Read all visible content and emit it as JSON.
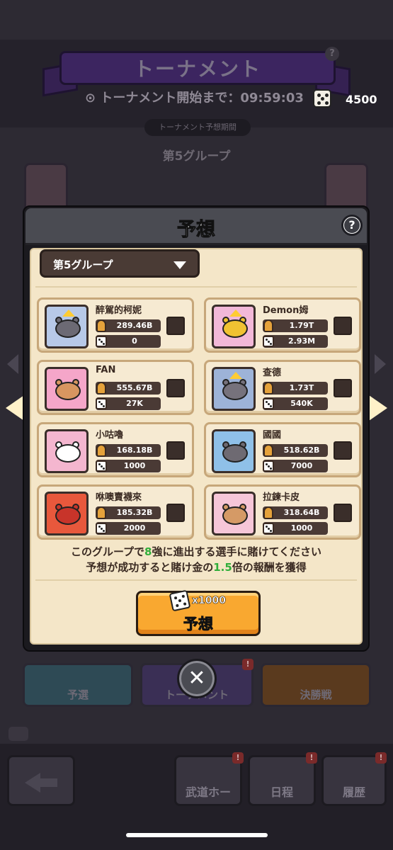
{
  "background": {
    "title": "トーナメント",
    "timer_label": "トーナメント開始まで：",
    "timer_value": "09:59:03",
    "currency": "4500",
    "period_label": "トーナメント予想期間",
    "group_label": "第5グループ",
    "stages": [
      "予選",
      "トーナメント",
      "決勝戦"
    ],
    "nav": [
      "武道ホー",
      "日程",
      "履歴"
    ]
  },
  "modal": {
    "title": "予想",
    "help_label": "?",
    "selected_group": "第5グループ",
    "players": [
      {
        "name": "醉駕的柯妮",
        "power": "289.46B",
        "bet": "0"
      },
      {
        "name": "Demon姆",
        "power": "1.79T",
        "bet": "2.93M"
      },
      {
        "name": "FAN",
        "power": "555.67B",
        "bet": "27K"
      },
      {
        "name": "查德",
        "power": "1.73T",
        "bet": "540K"
      },
      {
        "name": "小咕嚕",
        "power": "168.18B",
        "bet": "1000"
      },
      {
        "name": "國國",
        "power": "518.62B",
        "bet": "7000"
      },
      {
        "name": "咻噢賣襪來",
        "power": "185.32B",
        "bet": "2000"
      },
      {
        "name": "拉鍊卡皮",
        "power": "318.64B",
        "bet": "1000"
      }
    ],
    "info_line1_pre": "このグループで",
    "info_line1_num": "8",
    "info_line1_post": "強に進出する選手に賭けてください",
    "info_line2_pre": "予想が成功すると賭け金の",
    "info_line2_num": "1.5",
    "info_line2_post": "倍の報酬を獲得",
    "button_cost": "x1000",
    "button_label": "予想",
    "close_label": "✕"
  },
  "colors": {
    "accent_orange": "#f9a830",
    "highlight_green": "#2fae3a",
    "panel_cream": "#f4e6c8",
    "header_gray": "#4a4b52"
  }
}
